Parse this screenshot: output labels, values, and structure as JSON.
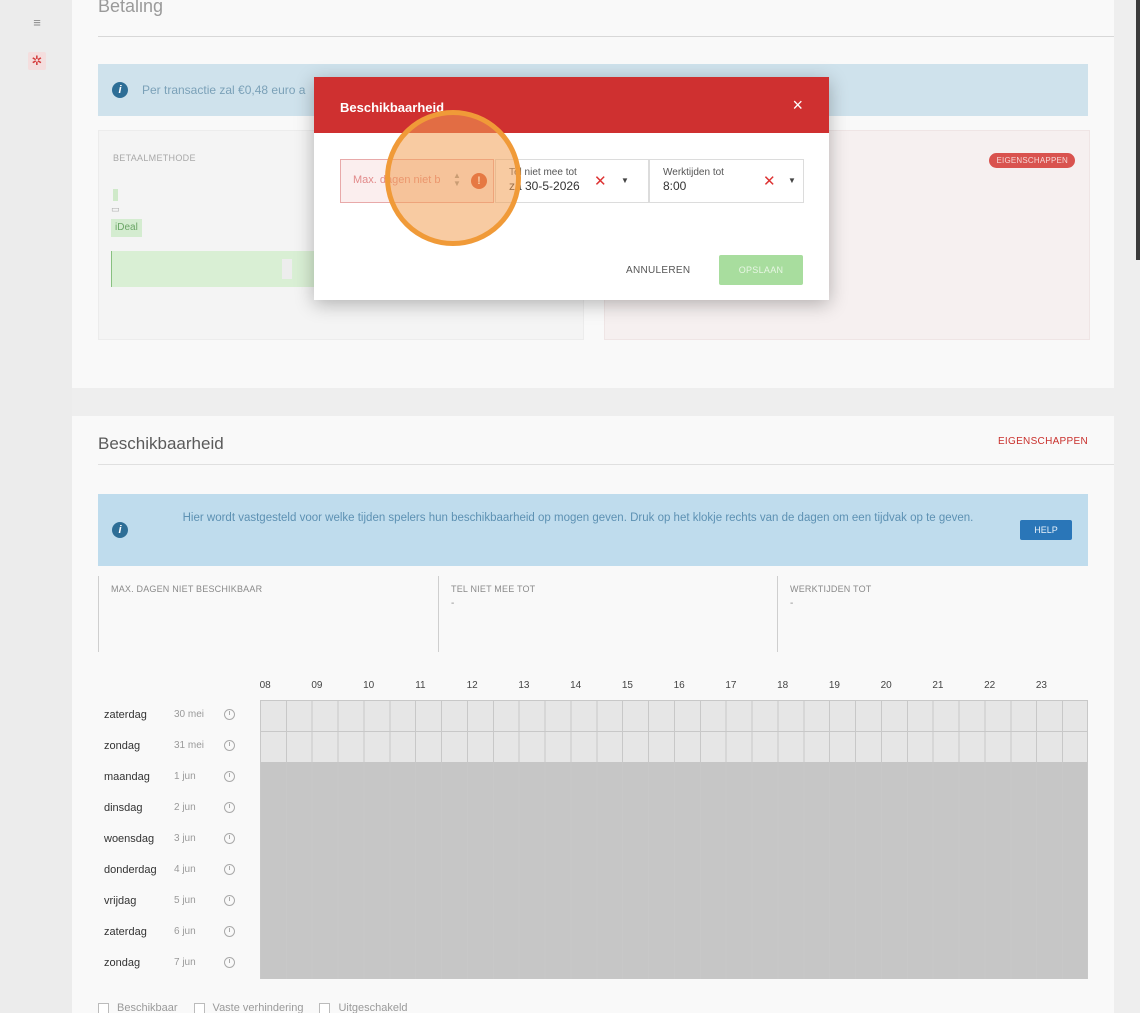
{
  "nav": {
    "items": [
      {
        "name": "layers-icon",
        "glyph": "≡",
        "active": false
      },
      {
        "name": "gear-icon",
        "glyph": "✲",
        "active": true
      }
    ]
  },
  "betaling": {
    "title": "Betaling",
    "info_text": "Per transactie zal €0,48 euro a",
    "method_label": "BETAALMETHODE",
    "method_value": "iDeal",
    "eigenschappen_label": "EIGENSCHAPPEN"
  },
  "beschikbaarheid": {
    "title": "Beschikbaarheid",
    "eigenschappen_label": "EIGENSCHAPPEN",
    "info_text": "Hier wordt vastgesteld voor welke tijden spelers hun beschikbaarheid op mogen geven. Druk op het klokje rechts van de dagen om een tijdvak op te geven.",
    "help_label": "HELP",
    "summary": [
      {
        "label": "MAX. DAGEN NIET BESCHIKBAAR",
        "value": ""
      },
      {
        "label": "TEL NIET MEE TOT",
        "value": "-"
      },
      {
        "label": "WERKTIJDEN TOT",
        "value": "-"
      }
    ],
    "hours": [
      "08",
      "09",
      "10",
      "11",
      "12",
      "13",
      "14",
      "15",
      "16",
      "17",
      "18",
      "19",
      "20",
      "21",
      "22",
      "23"
    ],
    "days": [
      {
        "day": "zaterdag",
        "date": "30 mei",
        "state": "light"
      },
      {
        "day": "zondag",
        "date": "31 mei",
        "state": "light"
      },
      {
        "day": "maandag",
        "date": "1 jun",
        "state": "dark"
      },
      {
        "day": "dinsdag",
        "date": "2 jun",
        "state": "dark"
      },
      {
        "day": "woensdag",
        "date": "3 jun",
        "state": "dark"
      },
      {
        "day": "donderdag",
        "date": "4 jun",
        "state": "dark"
      },
      {
        "day": "vrijdag",
        "date": "5 jun",
        "state": "dark"
      },
      {
        "day": "zaterdag",
        "date": "6 jun",
        "state": "dark"
      },
      {
        "day": "zondag",
        "date": "7 jun",
        "state": "dark"
      }
    ],
    "legend": [
      "Beschikbaar",
      "Vaste verhindering",
      "Uitgeschakeld"
    ]
  },
  "modal": {
    "title": "Beschikbaarheid",
    "close_glyph": "×",
    "max_dagen_placeholder": "Max. dagen niet b",
    "tel_label": "Tel niet mee tot",
    "tel_value": "za 30-5-2026",
    "werk_label": "Werktijden tot",
    "werk_value": "8:00",
    "cancel_label": "ANNULEREN",
    "save_label": "OPSLAAN"
  }
}
